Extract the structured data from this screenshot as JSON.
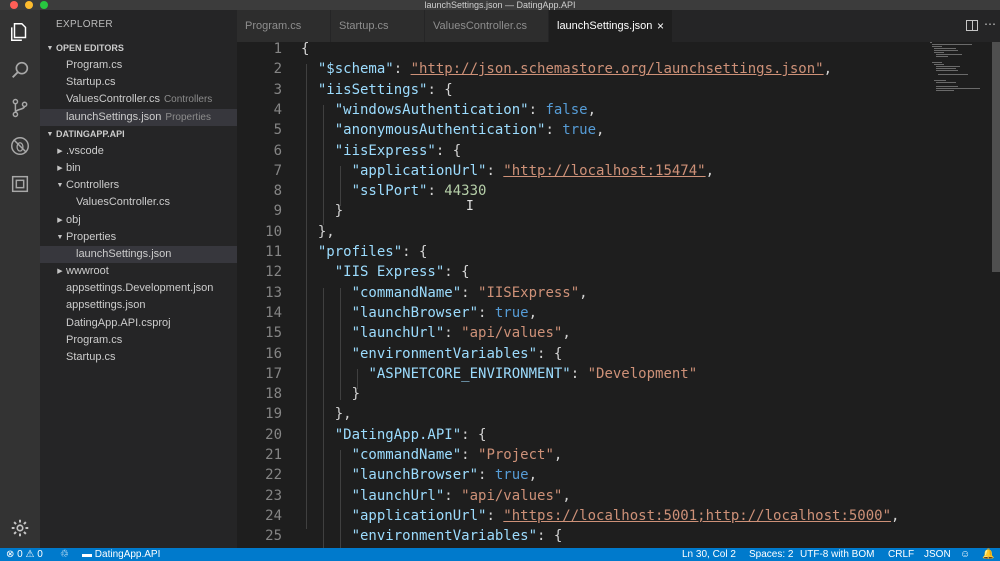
{
  "window": {
    "title": "launchSettings.json — DatingApp.API"
  },
  "activity_bar": {
    "items": [
      {
        "name": "explorer-icon"
      },
      {
        "name": "search-icon"
      },
      {
        "name": "source-control-icon"
      },
      {
        "name": "debug-icon"
      },
      {
        "name": "extensions-icon"
      }
    ],
    "settings": "gear-icon"
  },
  "sidebar": {
    "title": "EXPLORER",
    "open_editors": {
      "header": "OPEN EDITORS",
      "items": [
        {
          "label": "Program.cs",
          "desc": ""
        },
        {
          "label": "Startup.cs",
          "desc": ""
        },
        {
          "label": "ValuesController.cs",
          "desc": "Controllers"
        },
        {
          "label": "launchSettings.json",
          "desc": "Properties",
          "selected": true
        }
      ]
    },
    "project": {
      "header": "DATINGAPP.API",
      "items": [
        {
          "label": ".vscode",
          "type": "folder",
          "expanded": false
        },
        {
          "label": "bin",
          "type": "folder",
          "expanded": false
        },
        {
          "label": "Controllers",
          "type": "folder",
          "expanded": true
        },
        {
          "label": "ValuesController.cs",
          "type": "file",
          "depth": 2
        },
        {
          "label": "obj",
          "type": "folder",
          "expanded": false
        },
        {
          "label": "Properties",
          "type": "folder",
          "expanded": true
        },
        {
          "label": "launchSettings.json",
          "type": "file",
          "depth": 2,
          "selected": true
        },
        {
          "label": "wwwroot",
          "type": "folder",
          "expanded": false
        },
        {
          "label": "appsettings.Development.json",
          "type": "file",
          "depth": 1
        },
        {
          "label": "appsettings.json",
          "type": "file",
          "depth": 1
        },
        {
          "label": "DatingApp.API.csproj",
          "type": "file",
          "depth": 1
        },
        {
          "label": "Program.cs",
          "type": "file",
          "depth": 1
        },
        {
          "label": "Startup.cs",
          "type": "file",
          "depth": 1
        }
      ]
    }
  },
  "tabs": [
    {
      "label": "Program.cs",
      "active": false
    },
    {
      "label": "Startup.cs",
      "active": false
    },
    {
      "label": "ValuesController.cs",
      "active": false
    },
    {
      "label": "launchSettings.json",
      "active": true,
      "close": "×"
    }
  ],
  "editor": {
    "lines": [
      {
        "n": "1",
        "t": [
          [
            "p",
            "{"
          ]
        ]
      },
      {
        "n": "2",
        "t": [
          [
            "p",
            "  "
          ],
          [
            "k",
            "\"$schema\""
          ],
          [
            "p",
            ": "
          ],
          [
            "u",
            "\"http://json.schemastore.org/launchsettings.json\""
          ],
          [
            "p",
            ","
          ]
        ]
      },
      {
        "n": "3",
        "t": [
          [
            "p",
            "  "
          ],
          [
            "k",
            "\"iisSettings\""
          ],
          [
            "p",
            ": {"
          ]
        ]
      },
      {
        "n": "4",
        "t": [
          [
            "p",
            "    "
          ],
          [
            "k",
            "\"windowsAuthentication\""
          ],
          [
            "p",
            ": "
          ],
          [
            "b",
            "false"
          ],
          [
            "p",
            ","
          ]
        ]
      },
      {
        "n": "5",
        "t": [
          [
            "p",
            "    "
          ],
          [
            "k",
            "\"anonymousAuthentication\""
          ],
          [
            "p",
            ": "
          ],
          [
            "b",
            "true"
          ],
          [
            "p",
            ","
          ]
        ]
      },
      {
        "n": "6",
        "t": [
          [
            "p",
            "    "
          ],
          [
            "k",
            "\"iisExpress\""
          ],
          [
            "p",
            ": {"
          ]
        ]
      },
      {
        "n": "7",
        "t": [
          [
            "p",
            "      "
          ],
          [
            "k",
            "\"applicationUrl\""
          ],
          [
            "p",
            ": "
          ],
          [
            "u",
            "\"http://localhost:15474\""
          ],
          [
            "p",
            ","
          ]
        ]
      },
      {
        "n": "8",
        "t": [
          [
            "p",
            "      "
          ],
          [
            "k",
            "\"sslPort\""
          ],
          [
            "p",
            ": "
          ],
          [
            "n",
            "44330"
          ]
        ]
      },
      {
        "n": "9",
        "t": [
          [
            "p",
            "    }"
          ]
        ]
      },
      {
        "n": "10",
        "t": [
          [
            "p",
            "  },"
          ]
        ]
      },
      {
        "n": "11",
        "t": [
          [
            "p",
            "  "
          ],
          [
            "k",
            "\"profiles\""
          ],
          [
            "p",
            ": {"
          ]
        ]
      },
      {
        "n": "12",
        "t": [
          [
            "p",
            "    "
          ],
          [
            "k",
            "\"IIS Express\""
          ],
          [
            "p",
            ": {"
          ]
        ]
      },
      {
        "n": "13",
        "t": [
          [
            "p",
            "      "
          ],
          [
            "k",
            "\"commandName\""
          ],
          [
            "p",
            ": "
          ],
          [
            "s",
            "\"IISExpress\""
          ],
          [
            "p",
            ","
          ]
        ]
      },
      {
        "n": "14",
        "t": [
          [
            "p",
            "      "
          ],
          [
            "k",
            "\"launchBrowser\""
          ],
          [
            "p",
            ": "
          ],
          [
            "b",
            "true"
          ],
          [
            "p",
            ","
          ]
        ]
      },
      {
        "n": "15",
        "t": [
          [
            "p",
            "      "
          ],
          [
            "k",
            "\"launchUrl\""
          ],
          [
            "p",
            ": "
          ],
          [
            "s",
            "\"api/values\""
          ],
          [
            "p",
            ","
          ]
        ]
      },
      {
        "n": "16",
        "t": [
          [
            "p",
            "      "
          ],
          [
            "k",
            "\"environmentVariables\""
          ],
          [
            "p",
            ": {"
          ]
        ]
      },
      {
        "n": "17",
        "t": [
          [
            "p",
            "        "
          ],
          [
            "k",
            "\"ASPNETCORE_ENVIRONMENT\""
          ],
          [
            "p",
            ": "
          ],
          [
            "s",
            "\"Development\""
          ]
        ]
      },
      {
        "n": "18",
        "t": [
          [
            "p",
            "      }"
          ]
        ]
      },
      {
        "n": "19",
        "t": [
          [
            "p",
            "    },"
          ]
        ]
      },
      {
        "n": "20",
        "t": [
          [
            "p",
            "    "
          ],
          [
            "k",
            "\"DatingApp.API\""
          ],
          [
            "p",
            ": {"
          ]
        ]
      },
      {
        "n": "21",
        "t": [
          [
            "p",
            "      "
          ],
          [
            "k",
            "\"commandName\""
          ],
          [
            "p",
            ": "
          ],
          [
            "s",
            "\"Project\""
          ],
          [
            "p",
            ","
          ]
        ]
      },
      {
        "n": "22",
        "t": [
          [
            "p",
            "      "
          ],
          [
            "k",
            "\"launchBrowser\""
          ],
          [
            "p",
            ": "
          ],
          [
            "b",
            "true"
          ],
          [
            "p",
            ","
          ]
        ]
      },
      {
        "n": "23",
        "t": [
          [
            "p",
            "      "
          ],
          [
            "k",
            "\"launchUrl\""
          ],
          [
            "p",
            ": "
          ],
          [
            "s",
            "\"api/values\""
          ],
          [
            "p",
            ","
          ]
        ]
      },
      {
        "n": "24",
        "t": [
          [
            "p",
            "      "
          ],
          [
            "k",
            "\"applicationUrl\""
          ],
          [
            "p",
            ": "
          ],
          [
            "u",
            "\"https://localhost:5001;http://localhost:5000\""
          ],
          [
            "p",
            ","
          ]
        ]
      },
      {
        "n": "25",
        "t": [
          [
            "p",
            "      "
          ],
          [
            "k",
            "\"environmentVariables\""
          ],
          [
            "p",
            ": {"
          ]
        ]
      }
    ]
  },
  "status_bar": {
    "errors": "0",
    "warnings": "0",
    "folder": "DatingApp.API",
    "position": "Ln 30, Col 2",
    "spaces": "Spaces: 2",
    "encoding": "UTF-8 with BOM",
    "eol": "CRLF",
    "language": "JSON"
  }
}
